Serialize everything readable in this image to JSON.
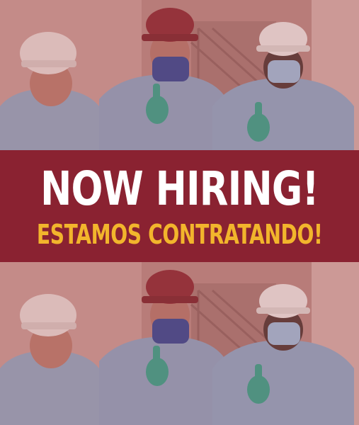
{
  "poster": {
    "headline": "NOW HIRING!",
    "subline": "ESTAMOS CONTRATANDO!"
  },
  "colors": {
    "banner_background": "#8a2231",
    "headline_text": "#ffffff",
    "subline_text": "#f2b52c",
    "photo_tint": "#b8706f"
  },
  "photo": {
    "subjects": [
      "worker-left",
      "worker-center",
      "worker-right"
    ],
    "repeated": true
  }
}
